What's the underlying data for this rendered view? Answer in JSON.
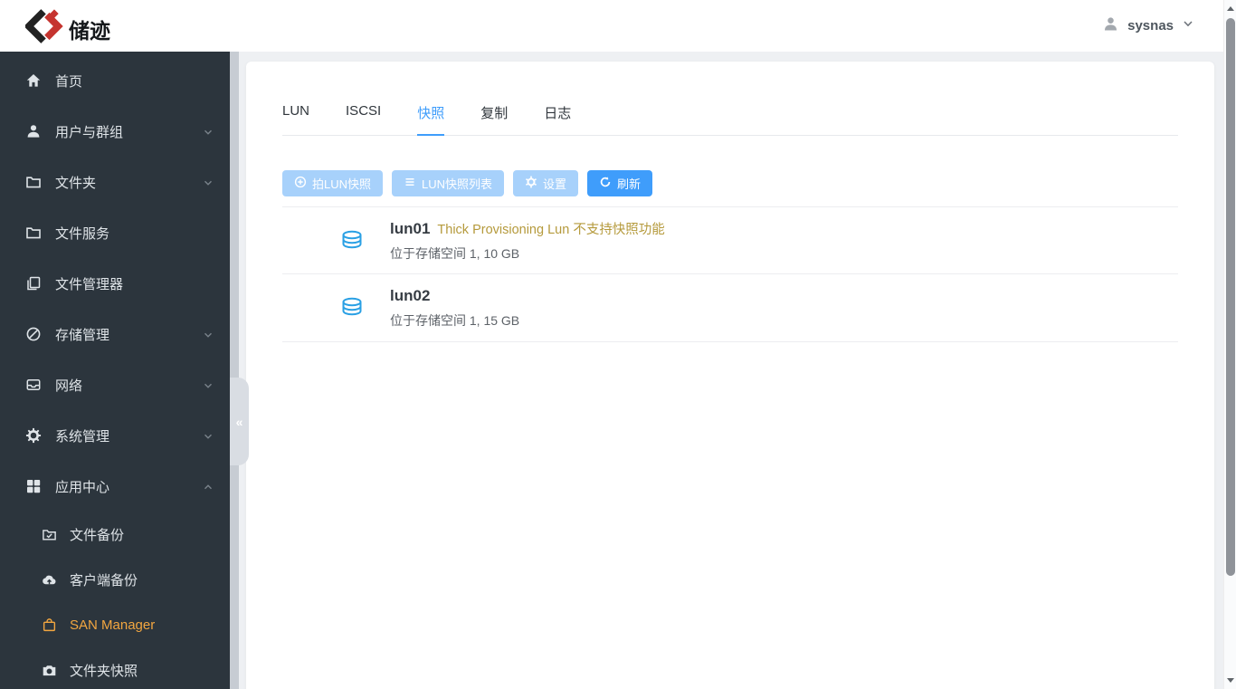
{
  "header": {
    "brand": "储迹",
    "username": "sysnas"
  },
  "sidebar": {
    "items": [
      {
        "label": "首页",
        "icon": "home-icon",
        "chevron": null
      },
      {
        "label": "用户与群组",
        "icon": "user-icon",
        "chevron": "down"
      },
      {
        "label": "文件夹",
        "icon": "folder-icon",
        "chevron": "down"
      },
      {
        "label": "文件服务",
        "icon": "folder-icon",
        "chevron": null
      },
      {
        "label": "文件管理器",
        "icon": "file-manager-icon",
        "chevron": null
      },
      {
        "label": "存储管理",
        "icon": "storage-icon",
        "chevron": "down"
      },
      {
        "label": "网络",
        "icon": "network-icon",
        "chevron": "down"
      },
      {
        "label": "系统管理",
        "icon": "gear-icon",
        "chevron": "down"
      },
      {
        "label": "应用中心",
        "icon": "apps-icon",
        "chevron": "up"
      }
    ],
    "subitems": [
      {
        "label": "文件备份",
        "icon": "folder-check-icon",
        "active": false
      },
      {
        "label": "客户端备份",
        "icon": "cloud-backup-icon",
        "active": false
      },
      {
        "label": "SAN Manager",
        "icon": "bag-icon",
        "active": true
      },
      {
        "label": "文件夹快照",
        "icon": "camera-icon",
        "active": false
      }
    ],
    "collapse_glyph": "«"
  },
  "tabs": [
    {
      "label": "LUN",
      "active": false
    },
    {
      "label": "ISCSI",
      "active": false
    },
    {
      "label": "快照",
      "active": true
    },
    {
      "label": "复制",
      "active": false
    },
    {
      "label": "日志",
      "active": false
    }
  ],
  "toolbar": [
    {
      "label": "拍LUN快照",
      "icon": "plus-circle-icon",
      "enabled": false
    },
    {
      "label": "LUN快照列表",
      "icon": "list-icon",
      "enabled": false
    },
    {
      "label": "设置",
      "icon": "gear-icon",
      "enabled": false
    },
    {
      "label": "刷新",
      "icon": "refresh-icon",
      "enabled": true
    }
  ],
  "luns": [
    {
      "name": "lun01",
      "note": "Thick Provisioning Lun 不支持快照功能",
      "detail": "位于存储空间 1, 10 GB",
      "icon": "database-icon"
    },
    {
      "name": "lun02",
      "note": "",
      "detail": "位于存储空间 1, 15 GB",
      "icon": "database-icon"
    }
  ],
  "colors": {
    "sidebar_bg": "#2c353d",
    "active_item_orange": "#f2a640",
    "primary_blue": "#3f9dfb",
    "disabled_blue": "#a7d1fb",
    "warning_text": "#b59a3c",
    "lun_icon_blue": "#2aa0e4",
    "logo_black": "#222222",
    "logo_red": "#c5342f"
  }
}
